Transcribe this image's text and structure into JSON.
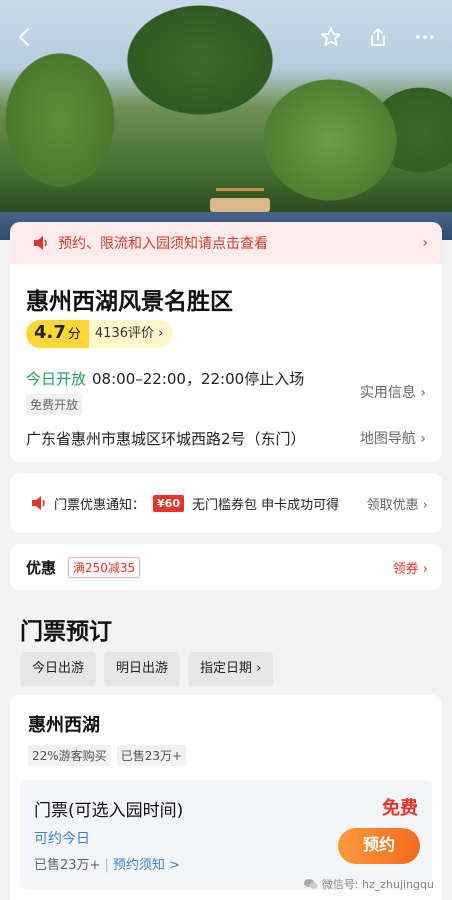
{
  "header": {
    "back_icon": "back-arrow-icon",
    "favorite_icon": "star-icon",
    "share_icon": "share-icon",
    "more_icon": "more-icon"
  },
  "notice": {
    "text": "预约、限流和入园须知请点击查看",
    "arrow": "›"
  },
  "scenic": {
    "title": "惠州西湖风景名胜区",
    "score": "4.7",
    "score_unit": "分",
    "reviews": "4136评价 ›",
    "open_status": "今日开放",
    "open_hours": "08:00–22:00，22:00停止入场",
    "free_tag": "免费开放",
    "practical_info": "实用信息 ›",
    "address": "广东省惠州市惠城区环城西路2号（东门）",
    "map_nav": "地图导航 ›"
  },
  "promo_notice": {
    "label": "门票优惠通知：",
    "coupon": "¥60",
    "desc": "无门槛券包 申卡成功可得",
    "action": "领取优惠 ›"
  },
  "discount": {
    "label": "优惠",
    "tag": "满250减35",
    "action": "领券 ›"
  },
  "booking": {
    "section_title": "门票预订",
    "dates": [
      "今日出游",
      "明日出游",
      "指定日期 ›"
    ],
    "product_title": "惠州西湖",
    "chips": [
      "22%游客购买",
      "已售23万+"
    ],
    "ticket": {
      "name": "门票(可选入园时间)",
      "price": "免费",
      "availability": "可约今日",
      "sold": "已售23万+",
      "sep": "|",
      "rules": "预约须知 >",
      "book_button": "预约"
    }
  },
  "watermark": "微信号: hz_zhujingqu",
  "colors": {
    "accent_red": "#e8332a",
    "open_green": "#1fa35a",
    "link_blue": "#3a86c8",
    "button_orange": "#f26b1d"
  }
}
